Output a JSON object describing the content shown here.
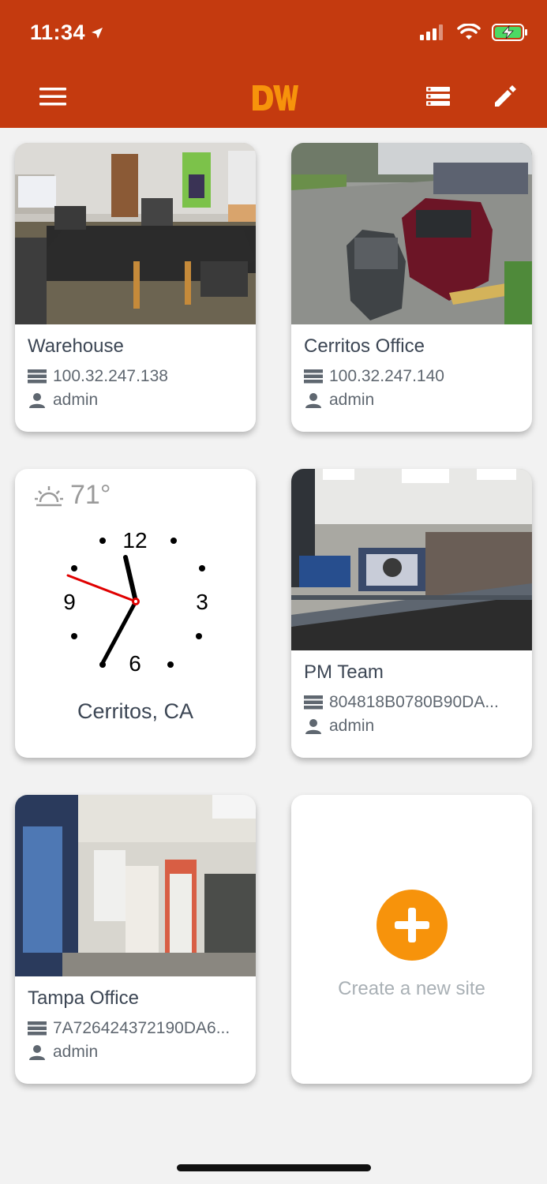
{
  "status_bar": {
    "time": "11:34"
  },
  "header": {
    "logo_text": "DW",
    "accent": "#c43a0f"
  },
  "sites": [
    {
      "name": "Warehouse",
      "address": "100.32.247.138",
      "user": "admin"
    },
    {
      "name": "Cerritos Office",
      "address": "100.32.247.140",
      "user": "admin"
    },
    {
      "name": "PM Team",
      "address": "804818B0780B90DA...",
      "user": "admin"
    },
    {
      "name": "Tampa Office",
      "address": "7A726424372190DA6...",
      "user": "admin"
    }
  ],
  "clock_widget": {
    "temperature": "71°",
    "city": "Cerritos, CA",
    "numerals": [
      "12",
      "3",
      "6",
      "9"
    ]
  },
  "create_site": {
    "label": "Create a new site",
    "button_color": "#f7930b"
  }
}
